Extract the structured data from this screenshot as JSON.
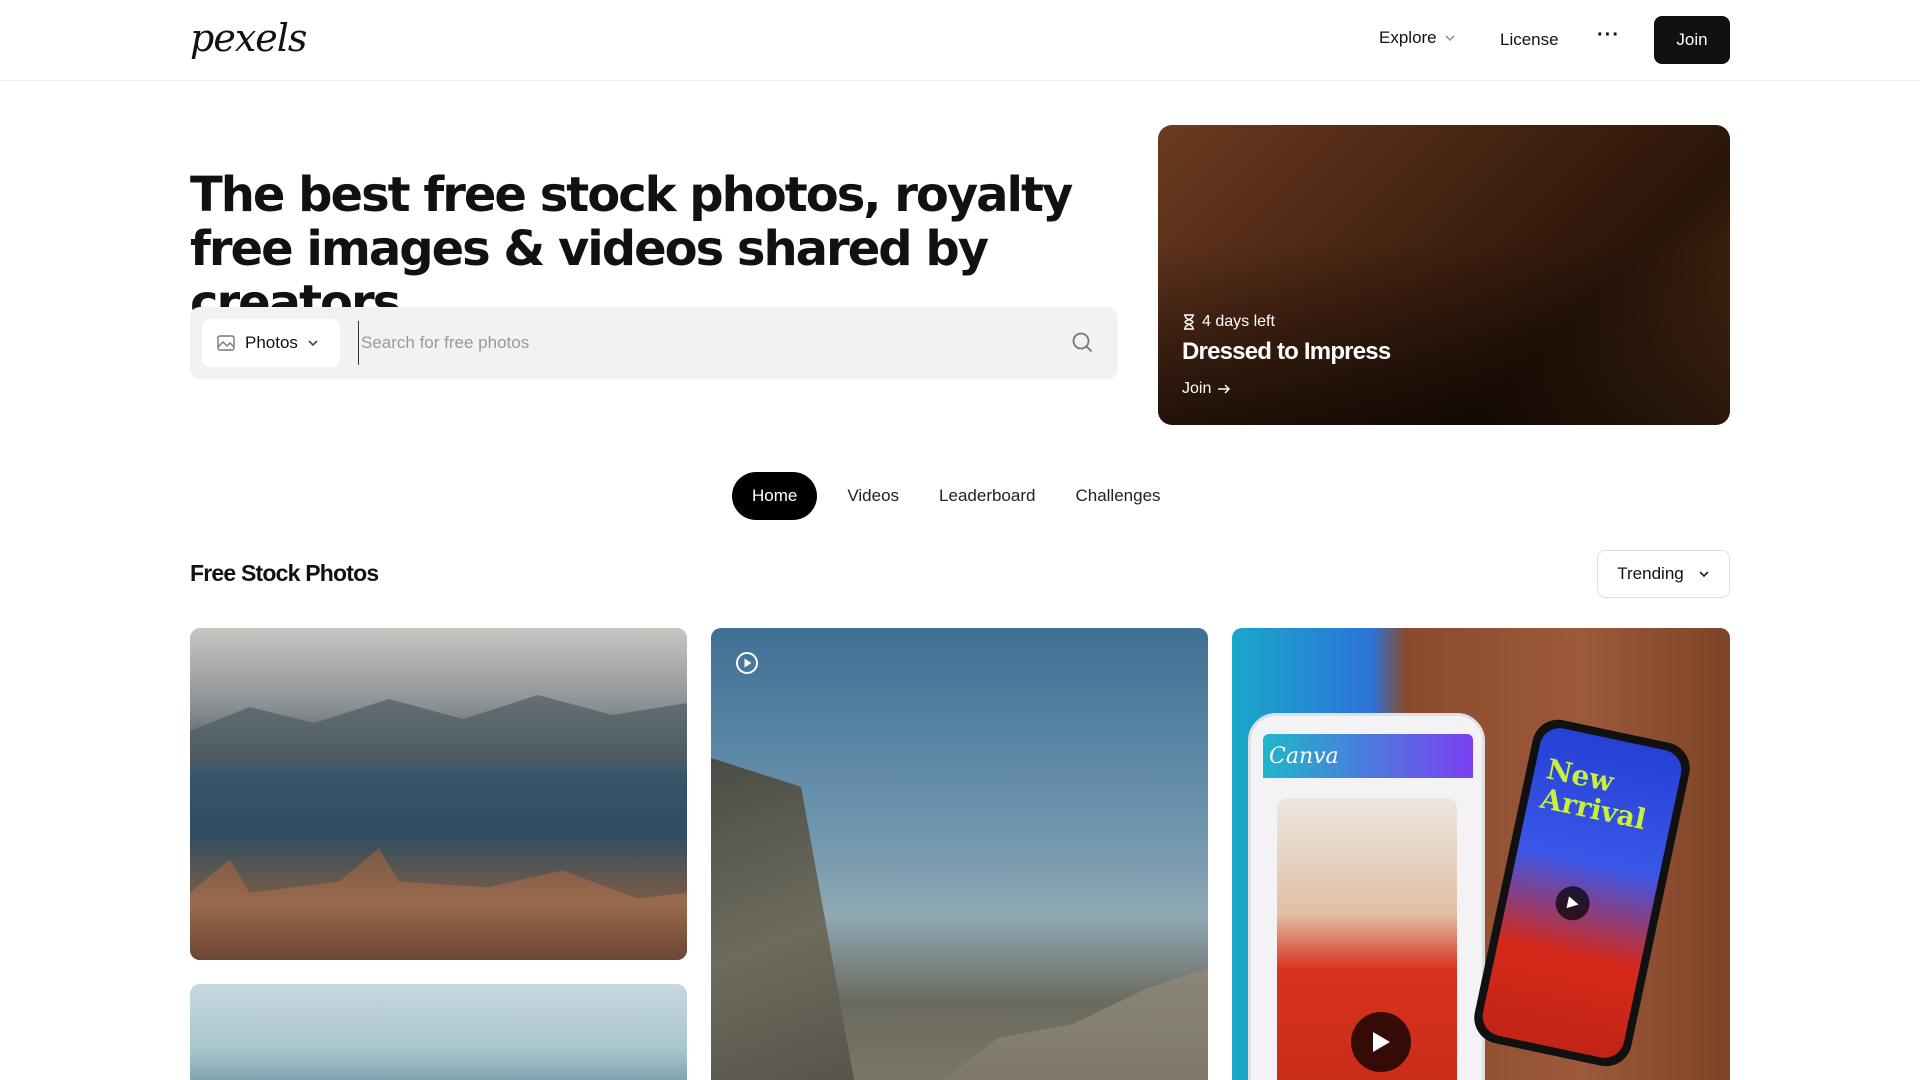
{
  "header": {
    "logo": "pexels",
    "nav": {
      "explore": "Explore",
      "license": "License",
      "more": "···"
    },
    "join_label": "Join"
  },
  "hero": {
    "title": "The best free stock photos, royalty free images & videos shared by creators.",
    "search": {
      "type_label": "Photos",
      "placeholder": "Search for free photos",
      "value": ""
    }
  },
  "challenge": {
    "days_left": "4 days left",
    "title": "Dressed to Impress",
    "join_label": "Join"
  },
  "tabs": [
    {
      "label": "Home",
      "active": true
    },
    {
      "label": "Videos",
      "active": false
    },
    {
      "label": "Leaderboard",
      "active": false
    },
    {
      "label": "Challenges",
      "active": false
    }
  ],
  "feed": {
    "title": "Free Stock Photos",
    "sort_label": "Trending"
  },
  "ad": {
    "brand": "Canva",
    "text": "New Arrival"
  },
  "colors": {
    "primary": "#000000",
    "search_bg": "#f2f2f2",
    "accent_green": "#c8f03c"
  },
  "icons": [
    "chevron-down-icon",
    "more-icon",
    "image-icon",
    "search-icon",
    "hourglass-icon",
    "arrow-right-icon",
    "play-circle-icon",
    "play-icon"
  ]
}
